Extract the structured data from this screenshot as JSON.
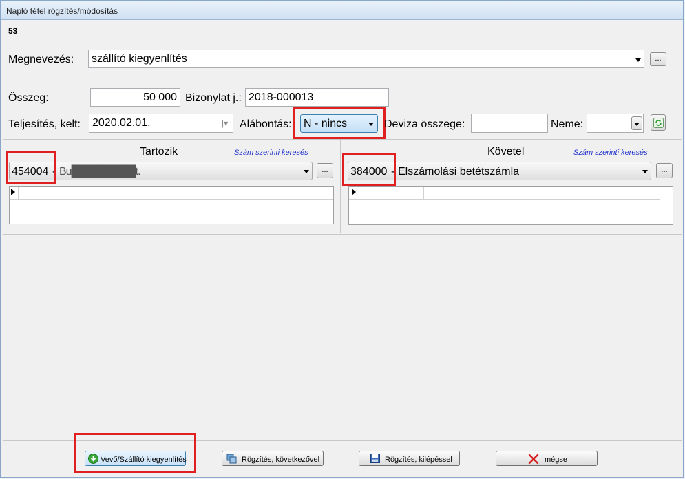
{
  "window": {
    "title": "Napló tétel rögzítés/módosítás"
  },
  "record_number": "53",
  "form": {
    "name_label": "Megnevezés:",
    "name_value": "szállító kiegyenlítés",
    "browse_label": "...",
    "amount_label": "Összeg:",
    "amount_value": "50 000",
    "voucher_label": "Bizonylat j.:",
    "voucher_value": "2018-000013",
    "date_label": "Teljesítés, kelt:",
    "date_value": "2020.02.01.",
    "split_label": "Alábontás:",
    "split_value": "N - nincs",
    "currency_amount_label": "Deviza összege:",
    "currency_amount_value": "",
    "currency_type_label": "Neme:",
    "currency_type_value": ""
  },
  "debit": {
    "title": "Tartozik",
    "search_link": "Szám szerinti keresés",
    "account_code": "454004",
    "account_name": "Bu█████████t.",
    "browse_label": "..."
  },
  "credit": {
    "title": "Követel",
    "search_link": "Szám szerinti keresés",
    "account_code": "384000",
    "account_name": "Elszámolási betétszámla",
    "browse_label": "..."
  },
  "buttons": {
    "settle": "Vevő/Szállító kiegyenlítés",
    "save_next": "Rögzítés, következővel",
    "save_exit": "Rögzítés, kilépéssel",
    "cancel": "mégse"
  },
  "colors": {
    "highlight": "#e02020",
    "link": "#2233cc",
    "selected_combo": "#cfe6fb"
  }
}
